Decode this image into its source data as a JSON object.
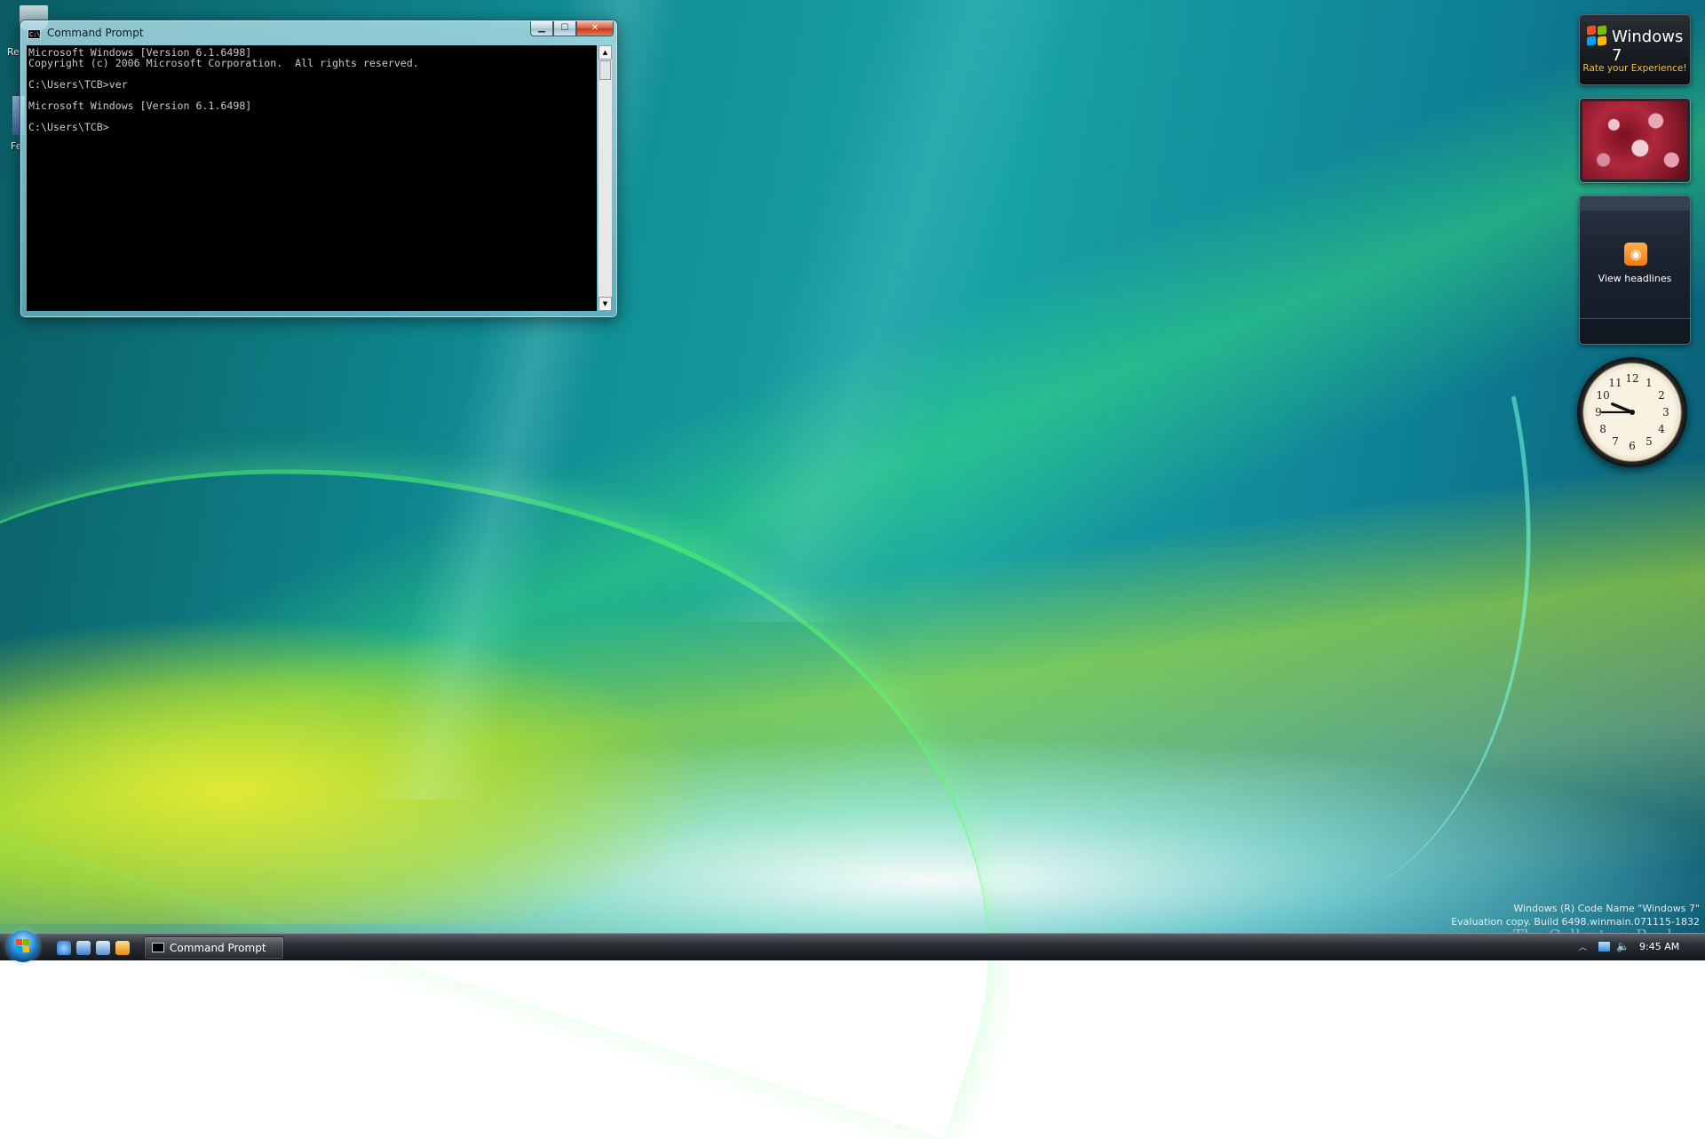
{
  "colors": {
    "console_bg": "#000000",
    "console_text": "#c9c9c9",
    "close_button": "#d9593d",
    "gadget_accent": "#f2c24a",
    "rss_orange": "#f07a12"
  },
  "desktop": {
    "icons": [
      {
        "label": "Re",
        "icon": "recycle-bin-icon"
      },
      {
        "label": "Fe",
        "icon": "feeds-icon"
      }
    ],
    "watermark": {
      "line1": "Windows (R) Code Name \"Windows 7\"",
      "line2": "Evaluation copy. Build 6498.winmain.071115-1832",
      "brand": "The Collectors Book"
    }
  },
  "window": {
    "title": "Command Prompt",
    "icon": "cmd-icon",
    "buttons": {
      "minimize": "minimize-icon",
      "maximize": "maximize-icon",
      "close": "close-icon"
    },
    "console_lines": [
      "Microsoft Windows [Version 6.1.6498]",
      "Copyright (c) 2006 Microsoft Corporation.  All rights reserved.",
      "",
      "C:\\Users\\TCB>ver",
      "",
      "Microsoft Windows [Version 6.1.6498]",
      "",
      "C:\\Users\\TCB>"
    ]
  },
  "gadgets": {
    "win7": {
      "title": "Windows 7",
      "subtitle": "Rate your Experience!"
    },
    "slideshow": {
      "alt": "photo-slideshow"
    },
    "feed": {
      "label": "View headlines",
      "icon": "rss-icon"
    },
    "clock": {
      "numbers": [
        "12",
        "1",
        "2",
        "3",
        "4",
        "5",
        "6",
        "7",
        "8",
        "9",
        "10",
        "11"
      ],
      "hour": 9,
      "minute": 45
    }
  },
  "taskbar": {
    "quick_launch": [
      "ie-icon",
      "show-desktop-icon",
      "switch-windows-icon",
      "media-player-icon"
    ],
    "tasks": [
      {
        "label": "Command Prompt",
        "icon": "cmd-icon",
        "active": true
      }
    ],
    "tray": {
      "time": "9:45 AM",
      "icons": [
        "network-icon",
        "volume-icon"
      ]
    }
  }
}
